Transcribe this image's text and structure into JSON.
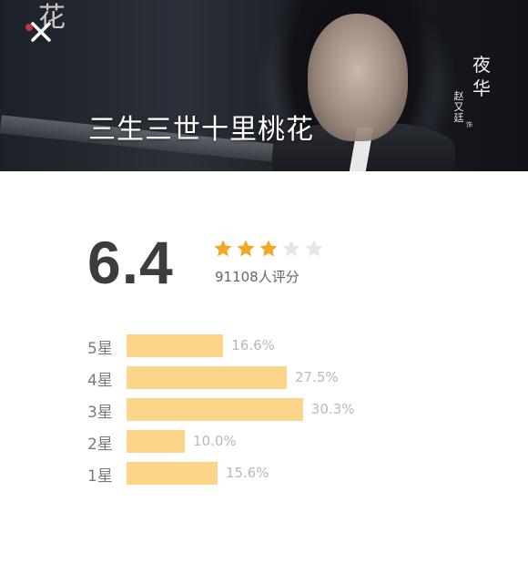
{
  "banner": {
    "title": "三生三世十里桃花",
    "calligraphy": "花",
    "character_name": "夜华",
    "actor_name": "赵又廷",
    "actor_role": "饰"
  },
  "rating": {
    "score": "6.4",
    "stars_filled": 3,
    "stars_total": 5,
    "star_color": "#f5a623",
    "star_empty_color": "#e6e6e6",
    "count_text": "91108人评分"
  },
  "distribution": [
    {
      "label": "5星",
      "percent": 16.6,
      "percent_text": "16.6%"
    },
    {
      "label": "4星",
      "percent": 27.5,
      "percent_text": "27.5%"
    },
    {
      "label": "3星",
      "percent": 30.3,
      "percent_text": "30.3%"
    },
    {
      "label": "2星",
      "percent": 10.0,
      "percent_text": "10.0%"
    },
    {
      "label": "1星",
      "percent": 15.6,
      "percent_text": "15.6%"
    }
  ],
  "colors": {
    "bar": "#fdd589",
    "score_text": "#3d3d3d"
  }
}
